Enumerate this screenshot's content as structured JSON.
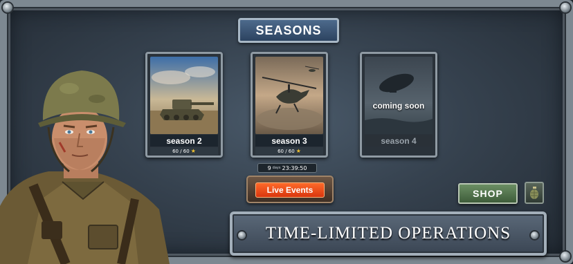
{
  "header": {
    "title": "SEASONS"
  },
  "seasons": [
    {
      "label": "season 2",
      "progress": "60 / 60",
      "locked": false
    },
    {
      "label": "season 3",
      "progress": "60 / 60",
      "locked": false
    },
    {
      "label": "season 4",
      "status": "coming soon",
      "locked": true
    }
  ],
  "event_timer": {
    "days_value": "9",
    "days_unit": "days",
    "time": "23:39:50"
  },
  "live_events": {
    "label": "Live Events"
  },
  "shop": {
    "label": "SHOP"
  },
  "banner": {
    "text": "TIME-LIMITED OPERATIONS"
  },
  "icons": {
    "star": "star-icon",
    "grenade": "grenade-icon",
    "soldier": "soldier-portrait"
  },
  "colors": {
    "live_events": "#e8471a",
    "shop": "#55784f",
    "title_plate": "#3d5878",
    "star": "#f2c230"
  }
}
